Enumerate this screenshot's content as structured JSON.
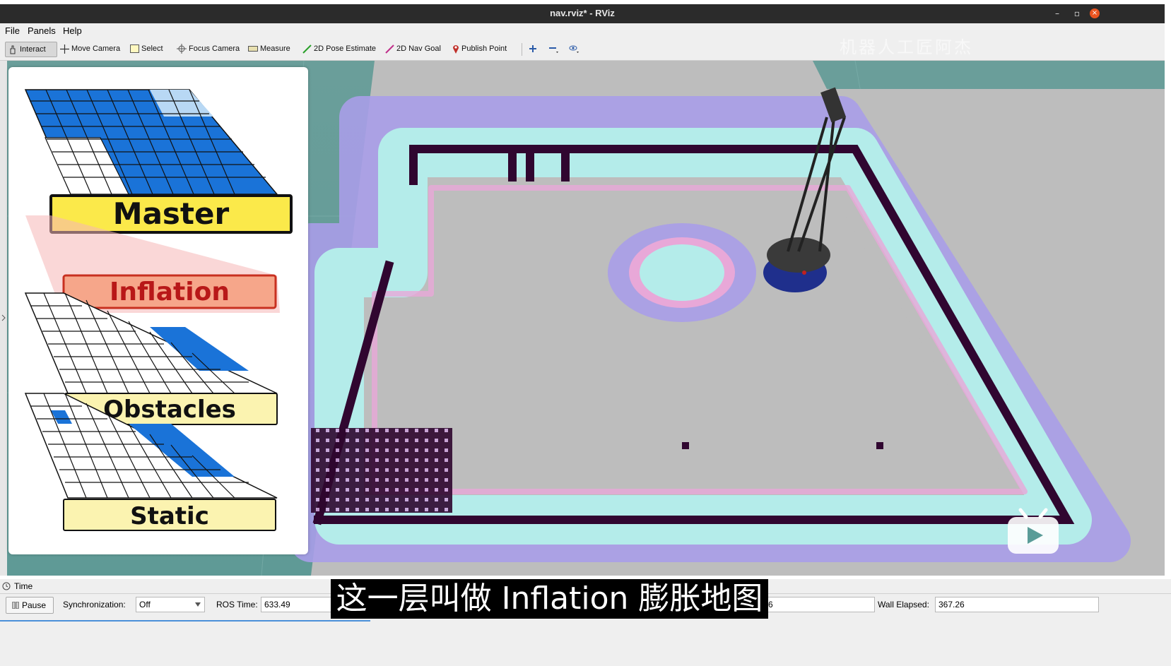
{
  "window": {
    "title": "nav.rviz* - RViz"
  },
  "menu": {
    "file": "File",
    "panels": "Panels",
    "help": "Help"
  },
  "toolbar": {
    "interact": "Interact",
    "move_camera": "Move Camera",
    "select": "Select",
    "focus_camera": "Focus Camera",
    "measure": "Measure",
    "pose_estimate": "2D Pose Estimate",
    "nav_goal": "2D Nav Goal",
    "publish_point": "Publish Point"
  },
  "diagram": {
    "layers": [
      {
        "label": "Master",
        "color": "#fbe94a"
      },
      {
        "label": "Inflation",
        "color": "#f6a68a"
      },
      {
        "label": "Obstacles",
        "color": "#fbf3b0"
      },
      {
        "label": "Static",
        "color": "#fbf3b0"
      }
    ]
  },
  "time_panel": {
    "title": "Time",
    "pause": "Pause",
    "sync_label": "Synchronization:",
    "sync_value": "Off",
    "ros_time_label": "ROS Time:",
    "ros_time_value": "633.49",
    "ros_elapsed_value": "6",
    "wall_elapsed_label": "Wall Elapsed:",
    "wall_elapsed_value": "367.26"
  },
  "overlay": {
    "subtitle": "这一层叫做 Inflation 膨胀地图",
    "watermark": "机器人工匠阿杰"
  },
  "colors": {
    "floor": "#5a9c98",
    "free_space": "#bfbfbf",
    "inflation_cyan": "#b4ecea",
    "inflation_purple": "#a99de8",
    "obstacle": "#3a0a3a",
    "robot_base": "#1f2f8c"
  }
}
